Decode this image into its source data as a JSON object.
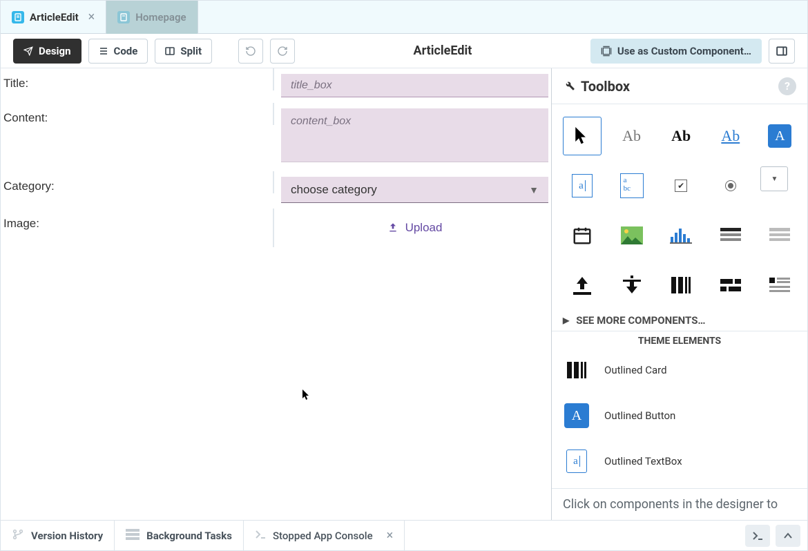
{
  "tabs": {
    "active": {
      "label": "ArticleEdit"
    },
    "inactive": {
      "label": "Homepage"
    }
  },
  "toolbar": {
    "design": "Design",
    "code": "Code",
    "split": "Split",
    "title": "ArticleEdit",
    "usecomp": "Use as Custom Component…"
  },
  "form": {
    "title": {
      "label": "Title:",
      "placeholder": "title_box"
    },
    "content": {
      "label": "Content:",
      "placeholder": "content_box"
    },
    "category": {
      "label": "Category:",
      "placeholder": "choose category"
    },
    "image": {
      "label": "Image:",
      "upload": "Upload"
    }
  },
  "toolbox": {
    "header": "Toolbox",
    "see_more": "SEE MORE COMPONENTS…",
    "theme_header": "THEME ELEMENTS",
    "theme_items": {
      "card": "Outlined Card",
      "button": "Outlined Button",
      "textbox": "Outlined TextBox"
    },
    "hint": "Click on components in the designer to"
  },
  "footer": {
    "version": "Version History",
    "tasks": "Background Tasks",
    "console": "Stopped App Console"
  },
  "tool_samples": {
    "Ab": "Ab",
    "link": "Ab",
    "A": "A",
    "a": "a",
    "abc": "a\nbc"
  }
}
